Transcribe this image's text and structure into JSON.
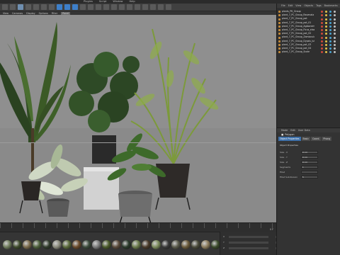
{
  "menubar": {
    "items": [
      "Plugins",
      "Script",
      "Window",
      "Help"
    ]
  },
  "mode_strip": {
    "items": [
      "View",
      "Cameras",
      "Display",
      "Options",
      "Filter",
      "Panel"
    ]
  },
  "object_manager": {
    "menu": [
      "File",
      "Edit",
      "View",
      "Objects",
      "Tags",
      "Bookmarks"
    ],
    "objects": [
      "plants_PK_Group",
      "plant_7_PC_Group_Ravenala",
      "plant_7_PC_Group_pot",
      "plant_7_PC_Group_pot_01",
      "plant_7_PC_Group_Aglaonema",
      "plant_7_PC_Group_Ficus_elastica",
      "plant_7_PC_Group_pot_02",
      "plant_7_PC_Group_Zamioculcas",
      "plant_7_PC_Group_Dypsis_lutescens",
      "plant_7_PC_Group_pot_03",
      "plant_7_PC_Group_pot_04",
      "plant_7_PC_Group_Scale"
    ]
  },
  "attributes": {
    "menu": [
      "Mode",
      "Edit",
      "User Data"
    ],
    "object_label": "Polygon",
    "tabs": [
      "Object Properties",
      "Basic",
      "Coord.",
      "Phong"
    ],
    "section_title": "Object Properties",
    "fields": [
      {
        "label": "Size . X",
        "value": "0 cm"
      },
      {
        "label": "Size . Y",
        "value": "0 cm"
      },
      {
        "label": "Size . Z",
        "value": "0 cm"
      },
      {
        "label": "Segments",
        "value": "1"
      },
      {
        "label": "Fillet",
        "value": ""
      },
      {
        "label": "Fillet Subdivision",
        "value": "5"
      }
    ]
  },
  "timeline": {
    "status": "0 F"
  },
  "materials": {
    "colors": [
      "#6e7b5a",
      "#3d4a2a",
      "#7a6a4a",
      "#4b5f3a",
      "#2f3a2a",
      "#8a8a7a",
      "#5a6a3a",
      "#6a4a2a",
      "#3a4a3a",
      "#7a7a7a",
      "#4a5a2a",
      "#5a4a3a",
      "#2a3a2a",
      "#6a7a4a",
      "#4a3a2a",
      "#7a8a5a",
      "#3a3a3a",
      "#5a5a4a",
      "#6a5a3a",
      "#4a4a3a",
      "#8a7a5a",
      "#3a4a2a"
    ]
  },
  "coordinates": {
    "labels": [
      "X",
      "Y",
      "Z"
    ]
  },
  "toolbar_icons": [
    "undo-icon",
    "redo-icon",
    "live-selection-icon",
    "move-icon",
    "scale-icon",
    "rotate-icon",
    "recent-icon",
    "x-axis-icon",
    "y-axis-icon",
    "z-axis-icon",
    "world-coord-icon",
    "render-view-icon",
    "render-icon",
    "render-settings-icon",
    "cube-icon",
    "pen-icon",
    "subdivision-icon",
    "cloner-icon",
    "deformer-icon",
    "floor-icon",
    "camera-icon",
    "light-icon"
  ]
}
